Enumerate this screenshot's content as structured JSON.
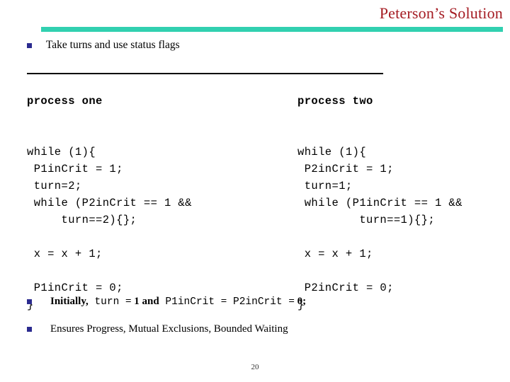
{
  "slide": {
    "title": "Peterson’s Solution",
    "page_number": "20",
    "accent_color": "#a41b22",
    "rule_color": "#31d0b0",
    "bullet_color": "#2b2b8f"
  },
  "top_bullet": {
    "marker": "square-bullet-icon",
    "text": "Take turns and use status flags"
  },
  "columns": [
    {
      "heading": "process one",
      "lines": [
        "while (1){",
        " P1inCrit = 1;",
        " turn=2;",
        " while (P2inCrit == 1 &&",
        "     turn==2){};",
        "",
        " x = x + 1;",
        "",
        " P1inCrit = 0;",
        "}"
      ]
    },
    {
      "heading": "process two",
      "lines": [
        "while (1){",
        " P2inCrit = 1;",
        " turn=1;",
        " while (P1inCrit == 1 &&",
        "         turn==1){};",
        "",
        " x = x + 1;",
        "",
        " P2inCrit = 0;",
        "}"
      ]
    }
  ],
  "bottom_bullets": [
    {
      "marker": "square-bullet-icon",
      "parts": [
        {
          "style": "serif-bold",
          "text": "Initially,"
        },
        {
          "style": "mono",
          "text": " turn "
        },
        {
          "style": "serif-bold",
          "text": "= 1 and"
        },
        {
          "style": "mono",
          "text": " P1inCrit "
        },
        {
          "style": "serif-bold",
          "text": "="
        },
        {
          "style": "mono",
          "text": " P2inCrit "
        },
        {
          "style": "serif-bold",
          "text": "= 0;"
        }
      ]
    },
    {
      "marker": "square-bullet-icon",
      "parts": [
        {
          "style": "serif-normal",
          "text": "Ensures Progress, Mutual Exclusions, Bounded Waiting"
        }
      ]
    }
  ]
}
